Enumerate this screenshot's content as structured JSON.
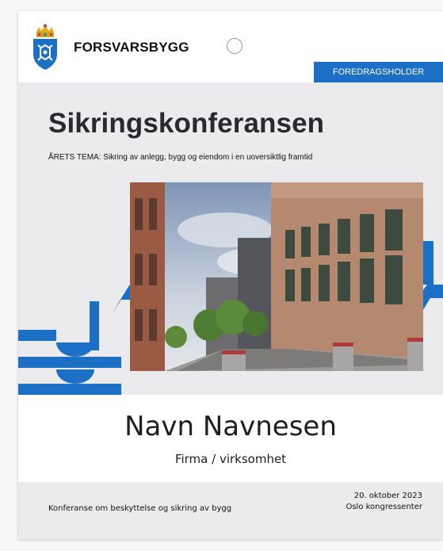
{
  "header": {
    "brand": "FORSVARSBYGG",
    "role_label": "FOREDRAGSHOLDER"
  },
  "conference": {
    "title": "Sikringskonferansen",
    "theme": "ÅRETS TEMA: Sikring av anlegg, bygg og eiendom i en uoversiktlig framtid"
  },
  "attendee": {
    "name": "Navn Navnesen",
    "company": "Firma / virksomhet"
  },
  "footer": {
    "description": "Konferanse om beskyttelse og sikring av bygg",
    "date": "20. oktober 2023",
    "venue": "Oslo kongressenter"
  },
  "colors": {
    "accent": "#1b6fc4",
    "panel": "#ebebee",
    "text": "#2a2a2e"
  },
  "icons": {
    "crest": "forsvarsbygg-crest-icon"
  }
}
